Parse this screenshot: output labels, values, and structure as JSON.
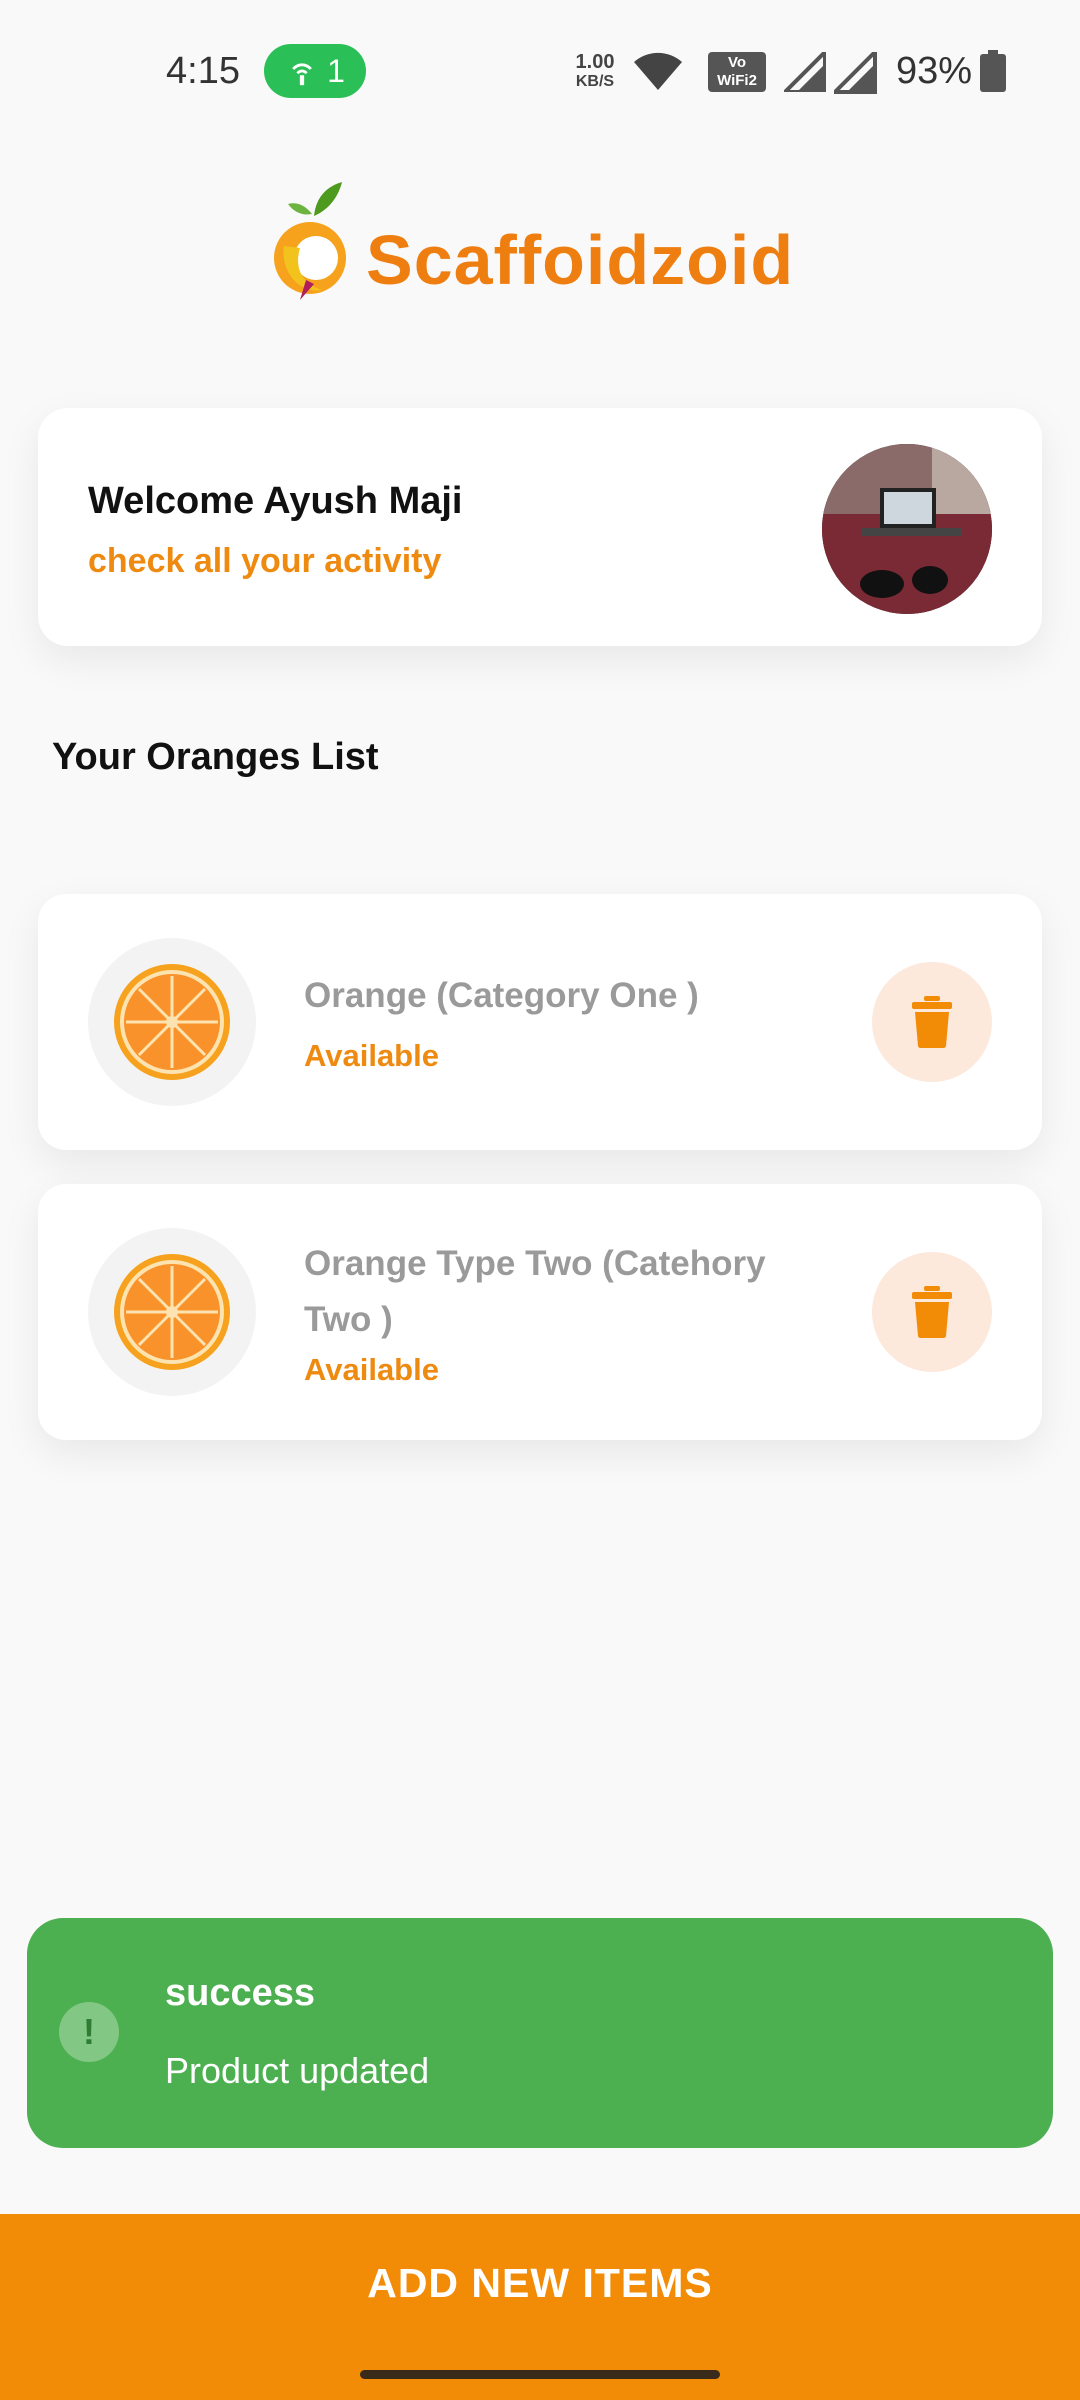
{
  "status_bar": {
    "time": "4:15",
    "hotspot_count": "1",
    "net_speed_value": "1.00",
    "net_speed_unit": "KB/S",
    "vowifi_line1": "Vo",
    "vowifi_line2": "WiFi2",
    "battery": "93%"
  },
  "brand": {
    "name": "Scaffoidzoid",
    "color": "#ef7e11"
  },
  "welcome": {
    "title": "Welcome Ayush Maji",
    "subtitle": "check all your activity"
  },
  "section_title": "Your Oranges List",
  "items": [
    {
      "name": "Orange  (Category One )",
      "status": "Available",
      "icon": "orange-slice-icon"
    },
    {
      "name": "Orange Type Two  (Catehory Two )",
      "status": "Available",
      "icon": "orange-slice-icon"
    }
  ],
  "snackbar": {
    "icon": "!",
    "title": "success",
    "message": "Product updated",
    "color": "#4caf50"
  },
  "actions": {
    "add_label": "ADD NEW ITEMS",
    "color": "#f28b06"
  }
}
